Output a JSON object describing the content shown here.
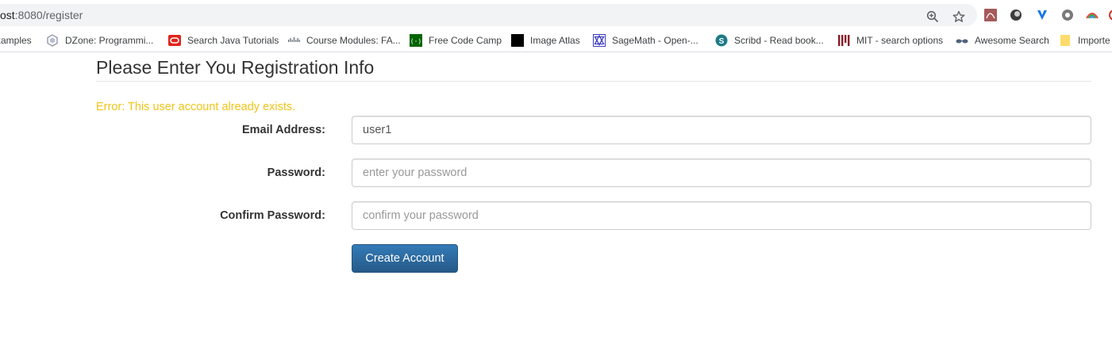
{
  "browser": {
    "url_host": "ost",
    "url_rest": ":8080/register",
    "bookmarks": [
      {
        "label": "xamples",
        "icon": "bookmark-partial-icon"
      },
      {
        "label": "DZone: Programmi...",
        "icon": "dzone-icon"
      },
      {
        "label": "Search Java Tutorials",
        "icon": "oracle-icon"
      },
      {
        "label": "Course Modules: FA...",
        "icon": "cisco-icon"
      },
      {
        "label": "Free Code Camp",
        "icon": "freecodecamp-icon"
      },
      {
        "label": "Image Atlas",
        "icon": "image-atlas-icon"
      },
      {
        "label": "SageMath - Open-...",
        "icon": "sagemath-icon"
      },
      {
        "label": "Scribd - Read book...",
        "icon": "scribd-icon"
      },
      {
        "label": "MIT - search options",
        "icon": "mit-icon"
      },
      {
        "label": "Awesome Search",
        "icon": "glasses-icon"
      },
      {
        "label": "Importe",
        "icon": "folder-icon"
      }
    ]
  },
  "page": {
    "title": "Please Enter You Registration Info",
    "error": "Error: This user account already exists.",
    "form": {
      "email_label": "Email Address:",
      "email_value": "user1",
      "password_label": "Password:",
      "password_placeholder": "enter your password",
      "confirm_label": "Confirm Password:",
      "confirm_placeholder": "confirm your password",
      "submit_label": "Create Account"
    }
  },
  "colors": {
    "error": "#f0c419",
    "primary_button": "#2e6da4"
  }
}
